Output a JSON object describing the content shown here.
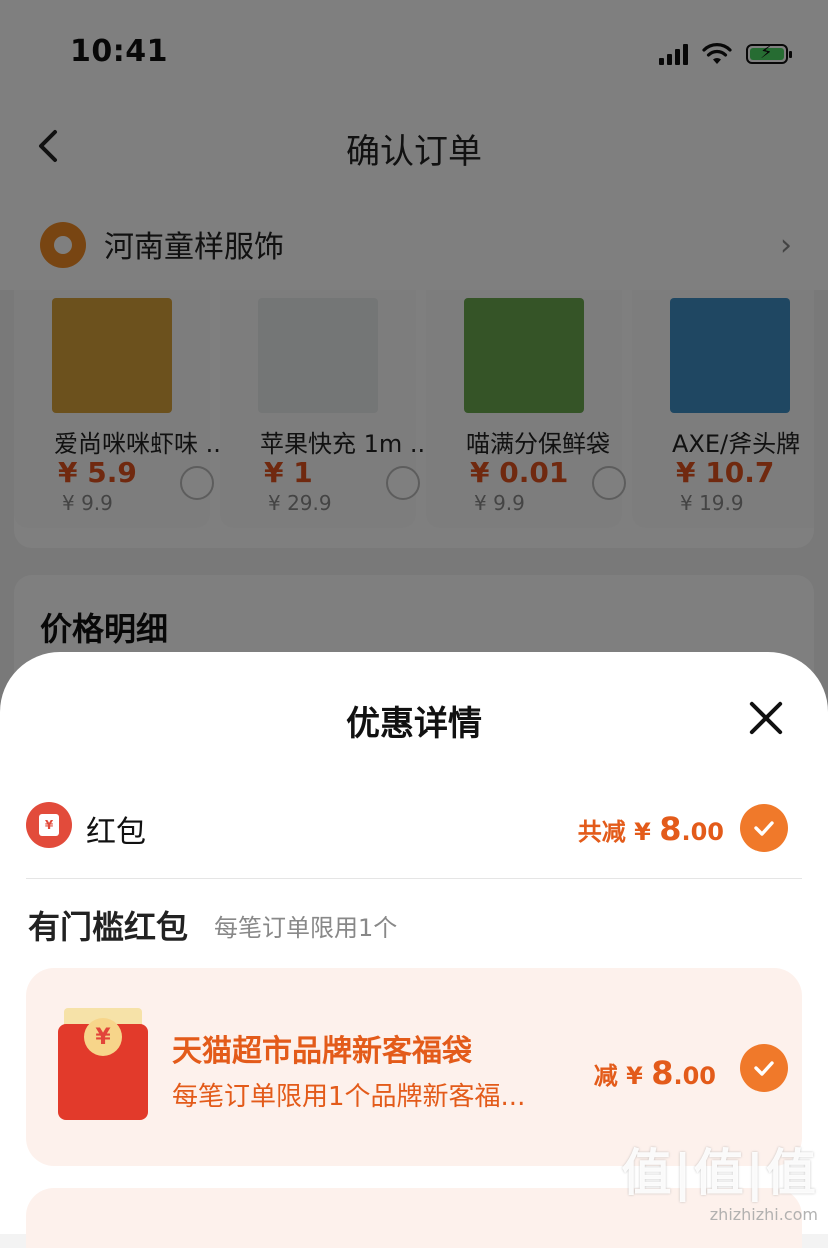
{
  "status_bar": {
    "time": "10:41"
  },
  "nav": {
    "title": "确认订单"
  },
  "shop": {
    "name": "河南童样服饰"
  },
  "products": [
    {
      "name": "爱尚咪咪虾味 ...",
      "price": "¥ 5.9",
      "orig_price": "¥ 9.9",
      "image": "snack-bag-image",
      "color": "#d9a33a"
    },
    {
      "name": "苹果快充 1m ...",
      "price": "¥ 1",
      "orig_price": "¥ 29.9",
      "image": "cable-box-image",
      "color": "#e9ecec"
    },
    {
      "name": "喵满分保鲜袋",
      "price": "¥ 0.01",
      "orig_price": "¥ 9.9",
      "image": "fresh-bag-image",
      "color": "#6aa84f"
    },
    {
      "name": "AXE/斧头牌",
      "price": "¥ 10.7",
      "orig_price": "¥ 19.9",
      "image": "cleaner-bottles-image",
      "color": "#3f8fc4"
    }
  ],
  "price_detail": {
    "title": "价格明细"
  },
  "sheet": {
    "title": "优惠详情",
    "hongbao": {
      "label": "红包",
      "total_prefix": "共减 ¥ ",
      "total_int": "8",
      "total_dec": ".00"
    },
    "section": {
      "title": "有门槛红包",
      "subtitle": "每笔订单限用1个"
    },
    "coupon": {
      "title": "天猫超市品牌新客福袋",
      "desc": "每笔订单限用1个品牌新客福...",
      "amount_prefix": "减 ¥ ",
      "amount_int": "8",
      "amount_dec": ".00"
    }
  },
  "watermark": {
    "logo": "值|值|值",
    "site": "zhizhizhi.com"
  },
  "colors": {
    "accent": "#e35b1a",
    "check": "#f0792a",
    "coupon_bg": "#fdf1ec"
  }
}
